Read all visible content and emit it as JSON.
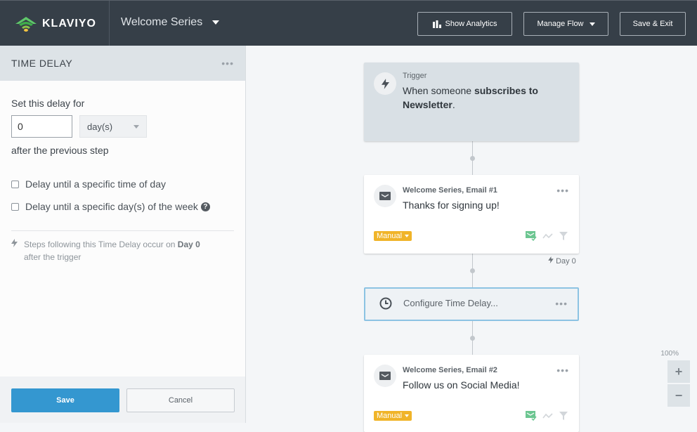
{
  "topbar": {
    "brand": "KLAVIYO",
    "flow_name": "Welcome Series",
    "buttons": {
      "show_analytics": "Show Analytics",
      "manage_flow": "Manage Flow",
      "save_exit": "Save & Exit"
    }
  },
  "panel": {
    "title": "TIME DELAY",
    "set_delay_label": "Set this delay for",
    "delay_value": "0",
    "delay_unit": "day(s)",
    "after_label": "after the previous step",
    "options": [
      {
        "label": "Delay until a specific time of day",
        "checked": false
      },
      {
        "label": "Delay until a specific day(s) of the week",
        "checked": false
      }
    ],
    "note_prefix": "Steps following this Time Delay occur on",
    "note_day": "Day 0",
    "note_suffix": "after the trigger",
    "save_label": "Save",
    "cancel_label": "Cancel"
  },
  "flow": {
    "trigger": {
      "label": "Trigger",
      "text_prefix": "When someone",
      "text_bold1": "subscribes to",
      "text_bold2": "Newsletter",
      "text_end": "."
    },
    "emails": [
      {
        "subtitle": "Welcome Series, Email #1",
        "title": "Thanks for signing up!",
        "status": "Manual"
      },
      {
        "subtitle": "Welcome Series, Email #2",
        "title": "Follow us on Social Media!",
        "status": "Manual"
      }
    ],
    "day_marker": "Day 0",
    "delay_node": "Configure Time Delay..."
  },
  "zoom": {
    "level": "100%",
    "in": "+",
    "out": "−"
  },
  "colors": {
    "primary": "#3497d0",
    "manual_badge": "#f0b429",
    "topbar": "#363f48",
    "selected_border": "#8cc3e3"
  }
}
